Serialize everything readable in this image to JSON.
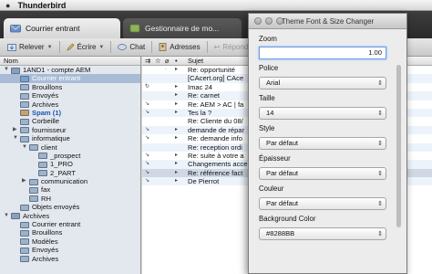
{
  "menubar": {
    "app_name": "Thunderbird"
  },
  "tabs": [
    {
      "label": "Courrier entrant"
    },
    {
      "label": "Gestionnaire de mo..."
    }
  ],
  "toolbar": {
    "relever": "Relever",
    "ecrire": "Écrire",
    "chat": "Chat",
    "adresses": "Adresses",
    "repondre": "Répondre"
  },
  "folder_pane": {
    "header": "Nom",
    "folders": [
      {
        "label": "1AND1 - compte AEM",
        "indent": 0,
        "twisty": "▼",
        "color": "#8aa0b8"
      },
      {
        "label": "Courrier entrant",
        "indent": 1,
        "color": "#7aa0cf",
        "selected": true
      },
      {
        "label": "Brouillons",
        "indent": 1,
        "color": "#9fb2c7"
      },
      {
        "label": "Envoyés",
        "indent": 1,
        "color": "#9fb2c7"
      },
      {
        "label": "Archives",
        "indent": 1,
        "color": "#9fb2c7"
      },
      {
        "label": "Spam (1)",
        "indent": 1,
        "color": "#d0a05a",
        "bold": true
      },
      {
        "label": "Corbeille",
        "indent": 1,
        "color": "#9fb2c7"
      },
      {
        "label": "fournisseur",
        "indent": 1,
        "twisty": "▶",
        "color": "#9fb2c7"
      },
      {
        "label": "informatique",
        "indent": 1,
        "twisty": "▼",
        "color": "#9fb2c7"
      },
      {
        "label": "client",
        "indent": 2,
        "twisty": "▼",
        "color": "#9fb2c7"
      },
      {
        "label": "_prospect",
        "indent": 3,
        "color": "#9fb2c7"
      },
      {
        "label": "1_PRO",
        "indent": 3,
        "color": "#9fb2c7"
      },
      {
        "label": "2_PART",
        "indent": 3,
        "color": "#9fb2c7"
      },
      {
        "label": "communication",
        "indent": 2,
        "twisty": "▶",
        "color": "#9fb2c7"
      },
      {
        "label": "fax",
        "indent": 2,
        "color": "#9fb2c7"
      },
      {
        "label": "RH",
        "indent": 2,
        "color": "#9fb2c7"
      },
      {
        "label": "Objets envoyés",
        "indent": 1,
        "color": "#9fb2c7"
      },
      {
        "label": "Archives",
        "indent": 0,
        "twisty": "▼",
        "color": "#8aa0b8"
      },
      {
        "label": "Courrier entrant",
        "indent": 1,
        "color": "#9fb2c7"
      },
      {
        "label": "Brouillons",
        "indent": 1,
        "color": "#9fb2c7"
      },
      {
        "label": "Modèles",
        "indent": 1,
        "color": "#9fb2c7"
      },
      {
        "label": "Envoyés",
        "indent": 1,
        "color": "#9fb2c7"
      },
      {
        "label": "Archives",
        "indent": 1,
        "color": "#9fb2c7"
      }
    ]
  },
  "message_list": {
    "subject_header": "Sujet",
    "messages": [
      {
        "subject": "Re: opportunité",
        "flags": [
          "",
          "·",
          "▸"
        ]
      },
      {
        "subject": "[CAcert.org] CAce",
        "flags": [
          "",
          "",
          ""
        ]
      },
      {
        "subject": "Imac 24",
        "flags": [
          "↻",
          "",
          "▸"
        ]
      },
      {
        "subject": "Re: carnet",
        "flags": [
          "",
          "",
          "▸"
        ]
      },
      {
        "subject": "Re: AEM > AC | fa",
        "flags": [
          "↘",
          "",
          "▸"
        ]
      },
      {
        "subject": "Tes la ?",
        "flags": [
          "↘",
          "",
          "▸"
        ]
      },
      {
        "subject": "Re: Cliente du 08/",
        "flags": [
          "",
          "",
          ""
        ]
      },
      {
        "subject": "demande de répar",
        "flags": [
          "↘",
          "",
          "▸"
        ]
      },
      {
        "subject": "Re: demande info",
        "flags": [
          "↘",
          "",
          "▸"
        ]
      },
      {
        "subject": "Re: reception ordi",
        "flags": [
          "",
          "",
          ""
        ]
      },
      {
        "subject": "Re: suite à votre a",
        "flags": [
          "↘",
          "",
          "▸"
        ]
      },
      {
        "subject": "Changements acce",
        "flags": [
          "↘",
          "",
          "▸"
        ]
      },
      {
        "subject": "Re: référence fact",
        "flags": [
          "↘",
          "",
          "▸"
        ],
        "selected": true
      },
      {
        "subject": "De Pierrot",
        "flags": [
          "↘",
          "",
          "▸"
        ]
      }
    ]
  },
  "dialog": {
    "title": "Theme Font & Size Changer",
    "zoom_label": "Zoom",
    "zoom_value": "1.00",
    "police_label": "Police",
    "police_value": "Arial",
    "taille_label": "Taille",
    "taille_value": "14",
    "style_label": "Style",
    "style_value": "Par défaut",
    "epaisseur_label": "Épaisseur",
    "epaisseur_value": "Par défaut",
    "couleur_label": "Couleur",
    "couleur_value": "Par défaut",
    "bgcolor_label": "Background Color",
    "bgcolor_value": "#8288BB"
  }
}
